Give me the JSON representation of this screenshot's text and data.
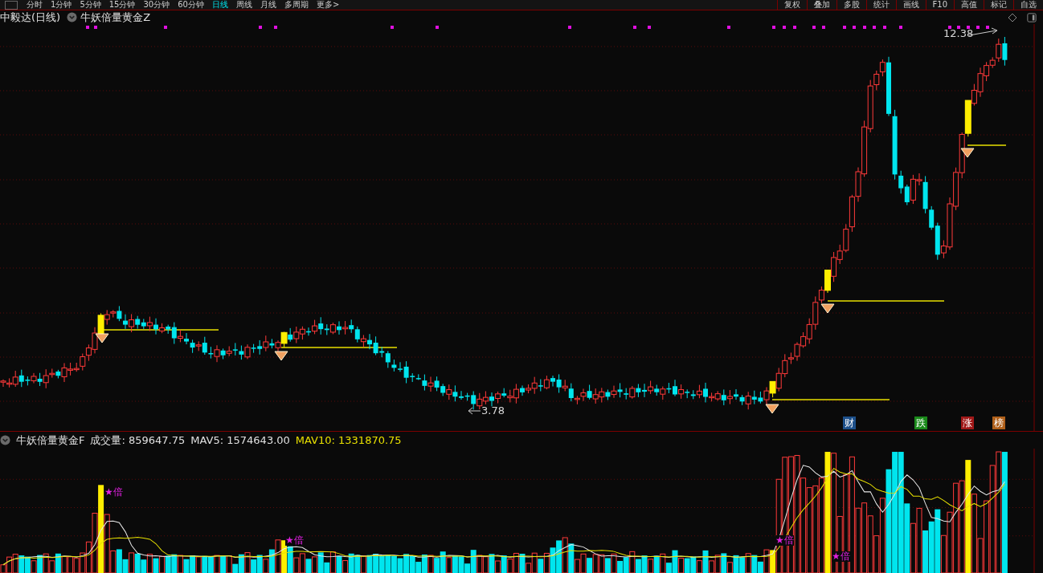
{
  "toolbar": {
    "periods": [
      {
        "label": "分时",
        "selected": false
      },
      {
        "label": "1分钟",
        "selected": false
      },
      {
        "label": "5分钟",
        "selected": false
      },
      {
        "label": "15分钟",
        "selected": false
      },
      {
        "label": "30分钟",
        "selected": false
      },
      {
        "label": "60分钟",
        "selected": false
      },
      {
        "label": "日线",
        "selected": true
      },
      {
        "label": "周线",
        "selected": false
      },
      {
        "label": "月线",
        "selected": false
      },
      {
        "label": "多周期",
        "selected": false
      },
      {
        "label": "更多>",
        "selected": false
      }
    ],
    "tools": [
      "复权",
      "叠加",
      "多股",
      "统计",
      "画线",
      "F10",
      "高值",
      "标记",
      "自选"
    ]
  },
  "chart_header": {
    "stock": "中毅达(日线)",
    "indicator": "牛妖倍量黄金Z"
  },
  "price_marks": {
    "high": "12.38",
    "low": "3.78"
  },
  "event_badges": [
    {
      "label": "财",
      "color": "#1c4f8a"
    },
    {
      "label": "跌",
      "color": "#1a8a1a"
    },
    {
      "label": "涨",
      "color": "#a01818"
    },
    {
      "label": "榜",
      "color": "#b0601a"
    }
  ],
  "volume_header": {
    "indicator": "牛妖倍量黄金F",
    "items": [
      {
        "label": "成交量: 859647.75",
        "kind": "plain"
      },
      {
        "label": "MAV5: 1574643.00",
        "kind": "plain"
      },
      {
        "label": "MAV10: 1331870.75",
        "kind": "highlight"
      }
    ]
  },
  "volume_marks": [
    "★倍",
    "★倍",
    "★倍",
    "★倍"
  ]
}
